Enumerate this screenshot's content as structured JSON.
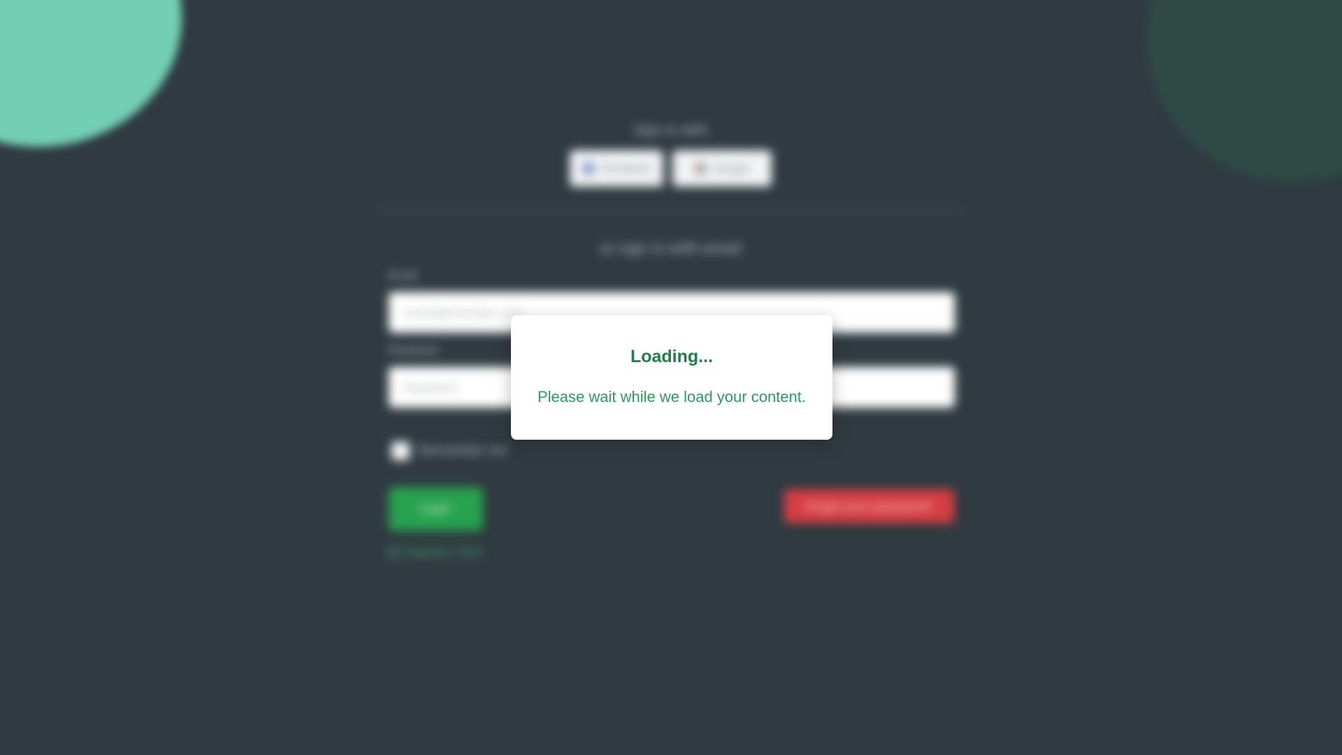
{
  "background": {
    "color": "#303b41",
    "blob_left_color": "#73cfb3",
    "blob_right_color": "#2f4a44"
  },
  "login_form": {
    "social_heading": "Sign in with",
    "social_buttons": [
      {
        "label": "Facebook",
        "icon": "facebook-icon"
      },
      {
        "label": "Google",
        "icon": "google-icon"
      }
    ],
    "subheading": "or sign in with email",
    "email": {
      "label": "Email",
      "placeholder": "name@example.com"
    },
    "password": {
      "label": "Password",
      "placeholder": "Password"
    },
    "remember_label": "Remember me",
    "login_label": "Login",
    "forgot_label": "Forgot your password?",
    "register_label": "Register Here",
    "colors": {
      "login": "#27a24f",
      "forgot": "#d63f43"
    }
  },
  "loading_modal": {
    "title": "Loading...",
    "message": "Please wait while we load your content.",
    "title_color": "#1f7f47",
    "message_color": "#29a05a"
  }
}
